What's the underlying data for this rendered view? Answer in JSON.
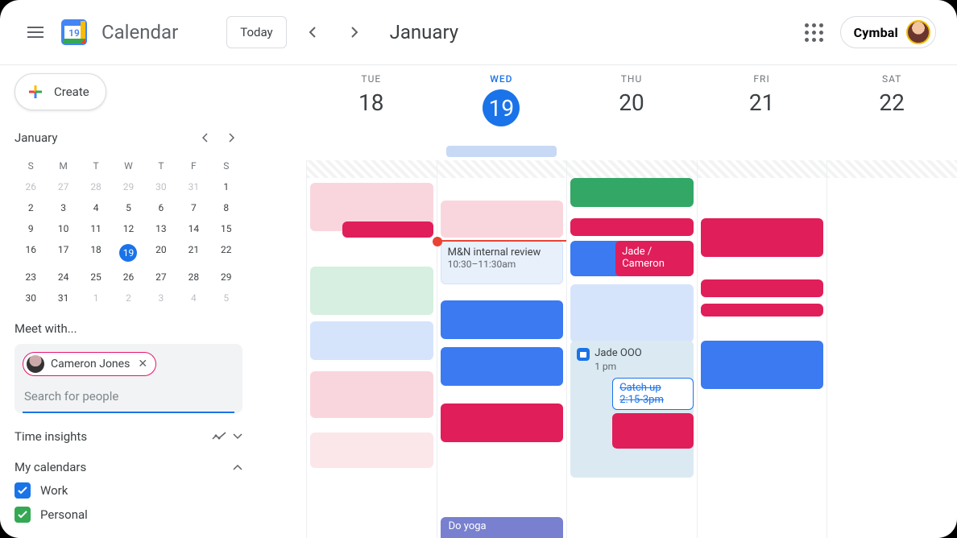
{
  "header": {
    "app_title": "Calendar",
    "today_label": "Today",
    "month_label": "January",
    "brand": "Cymbal",
    "logo_day": "19"
  },
  "sidebar": {
    "create_label": "Create",
    "mini_month_title": "January",
    "mini_dow": [
      "S",
      "M",
      "T",
      "W",
      "T",
      "F",
      "S"
    ],
    "mini_days": [
      {
        "n": "26",
        "dim": true
      },
      {
        "n": "27",
        "dim": true
      },
      {
        "n": "28",
        "dim": true
      },
      {
        "n": "29",
        "dim": true
      },
      {
        "n": "30",
        "dim": true
      },
      {
        "n": "31",
        "dim": true
      },
      {
        "n": "1"
      },
      {
        "n": "2"
      },
      {
        "n": "3"
      },
      {
        "n": "4"
      },
      {
        "n": "5"
      },
      {
        "n": "6"
      },
      {
        "n": "7"
      },
      {
        "n": "8"
      },
      {
        "n": "9"
      },
      {
        "n": "10"
      },
      {
        "n": "11"
      },
      {
        "n": "12"
      },
      {
        "n": "13"
      },
      {
        "n": "14"
      },
      {
        "n": "15"
      },
      {
        "n": "16"
      },
      {
        "n": "17"
      },
      {
        "n": "18"
      },
      {
        "n": "19",
        "today": true
      },
      {
        "n": "20"
      },
      {
        "n": "21"
      },
      {
        "n": "22"
      },
      {
        "n": "23"
      },
      {
        "n": "24"
      },
      {
        "n": "25"
      },
      {
        "n": "26"
      },
      {
        "n": "27"
      },
      {
        "n": "28"
      },
      {
        "n": "29"
      },
      {
        "n": "30"
      },
      {
        "n": "31"
      },
      {
        "n": "1",
        "dim": true
      },
      {
        "n": "2",
        "dim": true
      },
      {
        "n": "3",
        "dim": true
      },
      {
        "n": "4",
        "dim": true
      },
      {
        "n": "5",
        "dim": true
      }
    ],
    "meet_label": "Meet with...",
    "chip_name": "Cameron Jones",
    "search_placeholder": "Search for people",
    "time_insights_label": "Time insights",
    "my_calendars_label": "My calendars",
    "calendars": [
      {
        "name": "Work",
        "color": "blue"
      },
      {
        "name": "Personal",
        "color": "green"
      }
    ]
  },
  "week": {
    "days": [
      {
        "dow": "TUE",
        "num": "18"
      },
      {
        "dow": "WED",
        "num": "19",
        "active": true
      },
      {
        "dow": "THU",
        "num": "20"
      },
      {
        "dow": "FRI",
        "num": "21"
      },
      {
        "dow": "SAT",
        "num": "22"
      }
    ]
  },
  "events": {
    "mn_review": {
      "title": "M&N internal review",
      "time": "10:30–11:30am"
    },
    "jade_cameron": "Jade / Cameron",
    "ooo": {
      "title": "Jade OOO",
      "time": "1 pm"
    },
    "declined": {
      "title": "Catch up",
      "time": "2:15-3pm"
    },
    "yoga": "Do yoga"
  },
  "colors": {
    "pink_soft": "#f9d6dd",
    "pink_softer": "#fbe6ea",
    "magenta": "#e01e5a",
    "blue_soft": "#d6e4fb",
    "blue": "#3b7af0",
    "blue_mid": "#6f9bef",
    "blue_outline": "#d2e3fc",
    "green": "#33a766",
    "mint": "#d6efe0",
    "purple": "#7880cf"
  }
}
